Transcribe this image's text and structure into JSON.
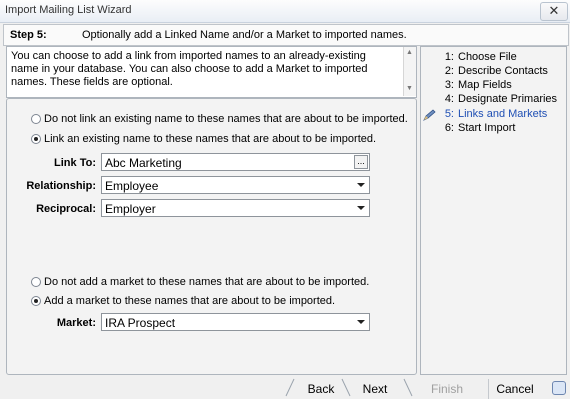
{
  "window": {
    "title": "Import Mailing List Wizard",
    "close_glyph": "✕"
  },
  "step_header": {
    "label": "Step 5:",
    "text": "Optionally add a Linked Name and/or a Market to imported names."
  },
  "description": "You can choose to add a link from imported names to an already-existing name in your database.  You can also choose to add a Market to imported names.  These fields are optional.",
  "link_section": {
    "option_no_link": "Do not link an existing name to these names that are about to be imported.",
    "option_link": "Link an existing name to these names that are about to be imported.",
    "selected": "link",
    "link_to_label": "Link To:",
    "link_to_value": "Abc Marketing",
    "link_to_browse": "...",
    "relationship_label": "Relationship:",
    "relationship_value": "Employee",
    "reciprocal_label": "Reciprocal:",
    "reciprocal_value": "Employer"
  },
  "market_section": {
    "option_no_market": "Do not add a market to these names that are about to be imported.",
    "option_market": "Add a market to these names that are about to be imported.",
    "selected": "market",
    "market_label": "Market:",
    "market_value": "IRA Prospect"
  },
  "steps": [
    {
      "num": "1:",
      "label": "Choose File"
    },
    {
      "num": "2:",
      "label": "Describe Contacts"
    },
    {
      "num": "3:",
      "label": "Map Fields"
    },
    {
      "num": "4:",
      "label": "Designate Primaries"
    },
    {
      "num": "5:",
      "label": "Links and Markets"
    },
    {
      "num": "6:",
      "label": "Start Import"
    }
  ],
  "active_step": 5,
  "buttons": {
    "back": "Back",
    "next": "Next",
    "finish": "Finish",
    "cancel": "Cancel"
  },
  "icons": {
    "current_step": "pencil-icon",
    "help": "help-icon"
  },
  "colors": {
    "active_step": "#1f4fb4",
    "disabled_text": "#a0a0a0"
  }
}
